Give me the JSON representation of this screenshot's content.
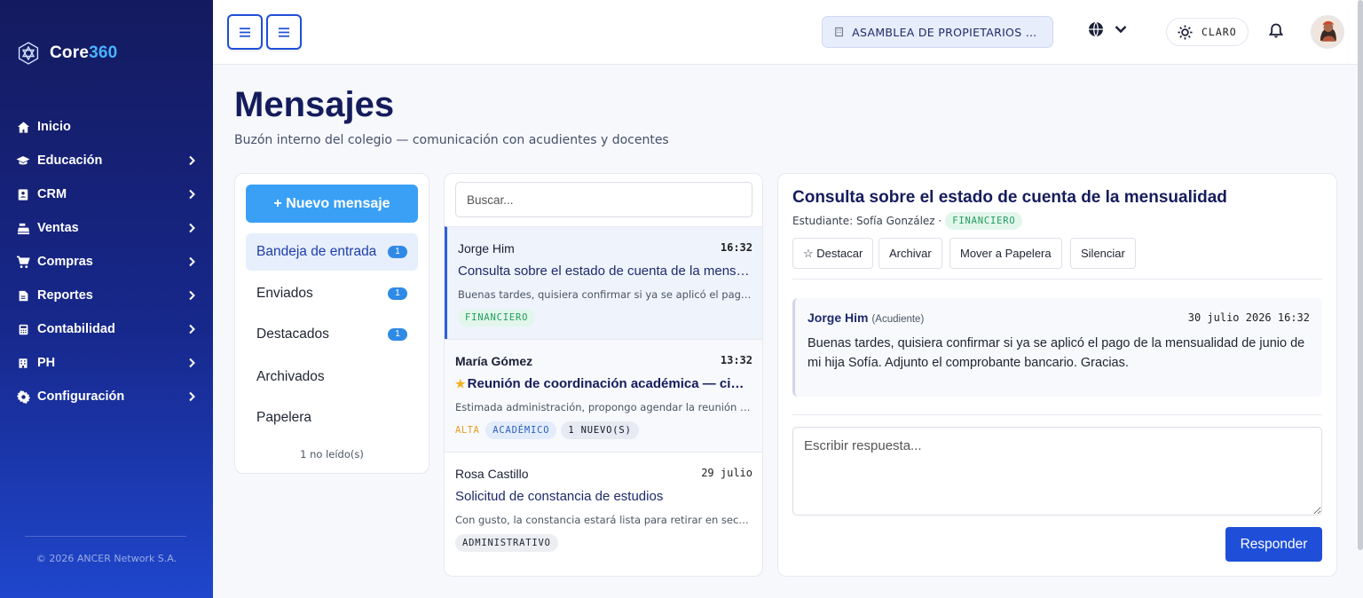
{
  "brand": {
    "name_a": "Core",
    "name_b": "360",
    "accent": "#49b3ff"
  },
  "sidebar": {
    "items": [
      {
        "label": "Inicio",
        "icon": "home-icon",
        "has_children": false
      },
      {
        "label": "Educación",
        "icon": "graduation-cap-icon",
        "has_children": true
      },
      {
        "label": "CRM",
        "icon": "contact-book-icon",
        "has_children": true
      },
      {
        "label": "Ventas",
        "icon": "cash-register-icon",
        "has_children": true
      },
      {
        "label": "Compras",
        "icon": "cart-icon",
        "has_children": true
      },
      {
        "label": "Reportes",
        "icon": "report-icon",
        "has_children": true
      },
      {
        "label": "Contabilidad",
        "icon": "calculator-icon",
        "has_children": true
      },
      {
        "label": "PH",
        "icon": "building-icon",
        "has_children": true
      },
      {
        "label": "Configuración",
        "icon": "gear-icon",
        "has_children": true
      }
    ],
    "copyright": "© 2026 ANCER Network S.A."
  },
  "topbar": {
    "org": "ASAMBLEA DE PROPIETARIOS DE ...",
    "theme_label": "CLARO"
  },
  "page": {
    "title": "Mensajes",
    "subtitle": "Buzón interno del colegio — comunicación con acudientes y docentes"
  },
  "folders": {
    "new_button": "+ Nuevo mensaje",
    "items": [
      {
        "label": "Bandeja de entrada",
        "badge": "1",
        "active": true
      },
      {
        "label": "Enviados",
        "badge": "1",
        "active": false
      },
      {
        "label": "Destacados",
        "badge": "1",
        "active": false
      },
      {
        "label": "Archivados",
        "badge": "",
        "active": false
      },
      {
        "label": "Papelera",
        "badge": "",
        "active": false
      }
    ],
    "unread_note": "1 no leído(s)"
  },
  "list": {
    "search_placeholder": "Buscar...",
    "messages": [
      {
        "from": "Jorge Him",
        "time": "16:32",
        "subject": "Consulta sobre el estado de cuenta de la mensualidad",
        "preview": "Buenas tardes, quisiera confirmar si ya se aplicó el pago de la mensualidad de junio de mi hija Sofía.",
        "priority": "",
        "tags": [
          "FINANCIERO"
        ]
      },
      {
        "from": "María Gómez",
        "time": "13:32",
        "subject": "Reunión de coordinación académica — cierre de periodo",
        "preview": "Estimada administración, propongo agendar la reunión de coordinación académica para el cierre del periodo.",
        "priority": "ALTA",
        "tags": [
          "ACADÉMICO",
          "1 NUEVO(S)"
        ]
      },
      {
        "from": "Rosa Castillo",
        "time": "29 julio",
        "subject": "Solicitud de constancia de estudios",
        "preview": "Con gusto, la constancia estará lista para retirar en secretaría el día de mañana.",
        "priority": "",
        "tags": [
          "ADMINISTRATIVO"
        ]
      }
    ]
  },
  "detail": {
    "title": "Consulta sobre el estado de cuenta de la mensualidad",
    "student": "Estudiante: Sofía González ·",
    "tag": "FINANCIERO",
    "actions": {
      "star": "☆ Destacar",
      "archive": "Archivar",
      "trash": "Mover a Papelera",
      "mute": "Silenciar"
    },
    "message": {
      "from": "Jorge Him",
      "role": "(Acudiente)",
      "date": "30 julio 2026 16:32",
      "body": "Buenas tardes, quisiera confirmar si ya se aplicó el pago de la mensualidad de junio de mi hija Sofía. Adjunto el comprobante bancario. Gracias."
    },
    "reply_placeholder": "Escribir respuesta...",
    "reply_button": "Responder"
  }
}
